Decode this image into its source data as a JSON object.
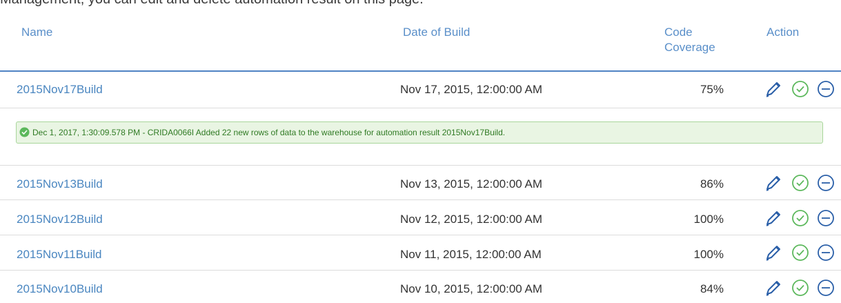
{
  "top_strip": {
    "text": "Management, you can edit and delete automation result on this page."
  },
  "table": {
    "headers": {
      "name": "Name",
      "date": "Date of Build",
      "coverage_line1": "Code",
      "coverage_line2": "Coverage",
      "action": "Action"
    },
    "rows": [
      {
        "name": "2015Nov17Build",
        "date": "Nov 17, 2015, 12:00:00 AM",
        "coverage": "75%"
      },
      {
        "name": "2015Nov13Build",
        "date": "Nov 13, 2015, 12:00:00 AM",
        "coverage": "86%"
      },
      {
        "name": "2015Nov12Build",
        "date": "Nov 12, 2015, 12:00:00 AM",
        "coverage": "100%"
      },
      {
        "name": "2015Nov11Build",
        "date": "Nov 11, 2015, 12:00:00 AM",
        "coverage": "100%"
      },
      {
        "name": "2015Nov10Build",
        "date": "Nov 10, 2015, 12:00:00 AM",
        "coverage": "84%"
      }
    ],
    "action_icons": [
      "edit-pencil-icon",
      "check-circle-icon",
      "minus-circle-icon"
    ]
  },
  "alert": {
    "icon": "check-circle-filled-icon",
    "message": "Dec 1, 2017, 1:30:09.578 PM - CRIDA0066I Added 22 new rows of data to the warehouse for automation result 2015Nov17Build."
  },
  "colors": {
    "link": "#4a86c0",
    "header_text": "#5a8fc9",
    "header_border": "#4f83c3",
    "success_green": "#5cb85c",
    "alert_bg": "#e9f5e3",
    "alert_text": "#2f7a23",
    "icon_blue": "#2a5fa8"
  }
}
